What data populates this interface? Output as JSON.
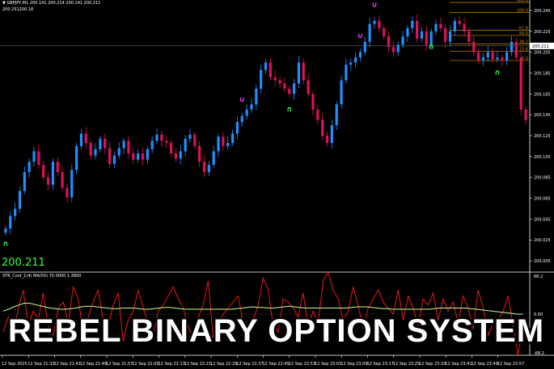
{
  "chart": {
    "symbol_line": "GBPJPY,M1  200.141 200.214 200.141 200.211",
    "sub_line": "200.251200.18",
    "current_price": "200.211",
    "current_price_tag": "200.211"
  },
  "indicator": {
    "label": "STR_Conf_1(4) MA(50) 70.0000 1.3800",
    "scale_top": "68.2",
    "scale_mid": "0.00",
    "scale_bottom": "-68.2"
  },
  "banner": {
    "text": "REBEL BINARY OPTION SYSTEM"
  },
  "fib_labels": [
    "161.8",
    "100.0",
    "61.8",
    "50.0",
    "38.2",
    "23.6",
    "0.0"
  ],
  "colors": {
    "bull": "#1e90ff",
    "bear": "#e0105a",
    "fib": "#d08a00",
    "signal_up": "#2dff4a",
    "signal_down": "#ff3cff",
    "ind_line": "#ff1a1a",
    "ma_line": "#ccff99"
  },
  "chart_data": {
    "type": "candlestick",
    "symbol": "GBPJPY",
    "timeframe": "M1",
    "ylim": [
      199.995,
      200.255
    ],
    "y_ticks": [
      "200.245",
      "200.225",
      "200.205",
      "200.185",
      "200.165",
      "200.145",
      "200.125",
      "200.105",
      "200.085",
      "200.065",
      "200.045",
      "200.025",
      "200.005"
    ],
    "x_ticks": [
      "12 Sep 2025",
      "12 Sep 21:33",
      "12 Sep 21:41",
      "12 Sep 21:49",
      "12 Sep 21:57",
      "12 Sep 22:05",
      "12 Sep 22:13",
      "12 Sep 22:21",
      "12 Sep 22:29",
      "12 Sep 22:37",
      "12 Sep 22:45",
      "12 Sep 22:53",
      "12 Sep 23:01",
      "12 Sep 23:09",
      "12 Sep 23:17",
      "12 Sep 23:25",
      "12 Sep 23:33",
      "12 Sep 23:41",
      "12 Sep 23:49",
      "12 Sep 23:57"
    ],
    "close": [
      200.036,
      200.048,
      200.055,
      200.072,
      200.09,
      200.1,
      200.11,
      200.097,
      200.085,
      200.078,
      200.1,
      200.09,
      200.075,
      200.066,
      200.092,
      200.115,
      200.127,
      200.118,
      200.106,
      200.112,
      200.122,
      200.113,
      200.098,
      200.106,
      200.113,
      200.12,
      200.108,
      200.102,
      200.108,
      200.102,
      200.112,
      200.12,
      200.126,
      200.12,
      200.118,
      200.108,
      200.103,
      200.11,
      200.122,
      200.126,
      200.115,
      200.1,
      200.09,
      200.097,
      200.11,
      200.124,
      200.115,
      200.118,
      200.127,
      200.138,
      200.144,
      200.15,
      200.155,
      200.17,
      200.188,
      200.195,
      200.181,
      200.178,
      200.175,
      200.17,
      200.165,
      200.175,
      200.195,
      200.178,
      200.165,
      200.15,
      200.14,
      200.125,
      200.118,
      200.135,
      200.155,
      200.178,
      200.193,
      200.195,
      200.2,
      200.205,
      200.215,
      200.232,
      200.235,
      200.228,
      200.22,
      200.21,
      200.205,
      200.212,
      200.22,
      200.228,
      200.235,
      200.218,
      200.225,
      200.212,
      200.225,
      200.232,
      200.228,
      200.215,
      200.225,
      200.235,
      200.232,
      200.225,
      200.215,
      200.205,
      200.197,
      200.2,
      200.205,
      200.198,
      200.2,
      200.197,
      200.205,
      200.215,
      200.2,
      200.15,
      200.14
    ],
    "fib_levels": {
      "161.8": 200.262,
      "100.0": 200.243,
      "61.8": 200.226,
      "50.0": 200.221,
      "38.2": 200.213,
      "23.6": 200.206,
      "0.0": 200.197
    },
    "signals": [
      {
        "type": "buy",
        "index": 0
      },
      {
        "type": "sell",
        "index": 50
      },
      {
        "type": "buy",
        "index": 60
      },
      {
        "type": "sell",
        "index": 75
      },
      {
        "type": "buy",
        "index": 90
      },
      {
        "type": "sell",
        "index": 78
      },
      {
        "type": "buy",
        "index": 104
      }
    ],
    "indicator_values": [
      -30,
      -5,
      -40,
      10,
      40,
      -20,
      5,
      -10,
      35,
      -20,
      -35,
      10,
      20,
      -15,
      45,
      25,
      -30,
      -5,
      20,
      40,
      -10,
      -20,
      15,
      35,
      -45,
      -10,
      5,
      40,
      10,
      -15,
      -35,
      5,
      15,
      30,
      45,
      25,
      10,
      -20,
      -40,
      -5,
      15,
      55,
      -40,
      -15,
      0,
      10,
      20,
      30,
      -15,
      -30,
      -10,
      15,
      60,
      40,
      -20,
      -30,
      25,
      20,
      10,
      -5,
      35,
      -20,
      5,
      -15,
      55,
      70,
      40,
      25,
      -10,
      5,
      45,
      15,
      -25,
      10,
      25,
      40,
      20,
      10,
      0,
      40,
      -10,
      30,
      10,
      -20,
      25,
      15,
      35,
      -10,
      25,
      5,
      20,
      -15,
      30,
      10,
      -25,
      40,
      10,
      -35,
      -15,
      -10,
      5,
      30,
      -20,
      -68,
      -15
    ],
    "ma_values": [
      5,
      8,
      12,
      15,
      18,
      18,
      16,
      14,
      12,
      10,
      9,
      8,
      8,
      9,
      10,
      12,
      13,
      13,
      12,
      11,
      10,
      9,
      9,
      10,
      10,
      10,
      9,
      8,
      8,
      9,
      10,
      11,
      11,
      10,
      9,
      8,
      8,
      8,
      8,
      8,
      8,
      8,
      8,
      8,
      8,
      9,
      10,
      11,
      12,
      11,
      11,
      10,
      10,
      11,
      12,
      13,
      12,
      11,
      10,
      10,
      10,
      10,
      10,
      10,
      10,
      10,
      10,
      11,
      12,
      12,
      12,
      11,
      10,
      9,
      9,
      8,
      8,
      8,
      8,
      8,
      8,
      8,
      8,
      9,
      10,
      10,
      10,
      10,
      10,
      10,
      9,
      8,
      7,
      6,
      5,
      4,
      3,
      2,
      1,
      0,
      0
    ]
  }
}
